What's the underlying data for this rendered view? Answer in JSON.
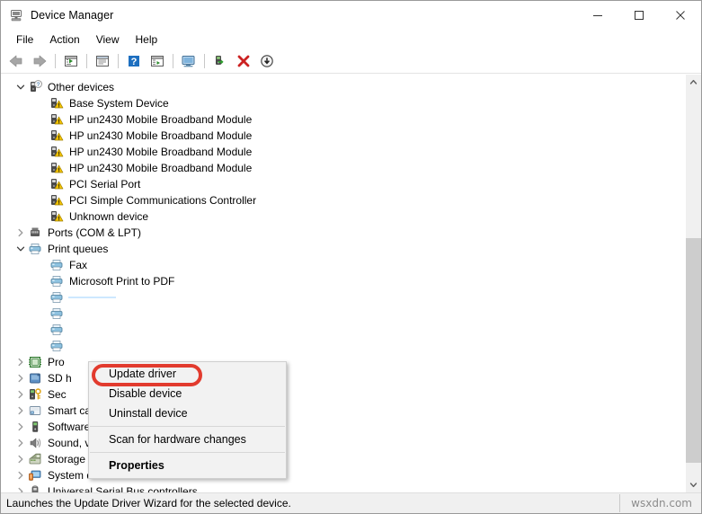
{
  "window": {
    "title": "Device Manager",
    "title_icon": "device-manager-icon",
    "controls": {
      "minimize": "minimize-icon",
      "maximize": "maximize-icon",
      "close": "close-icon"
    }
  },
  "menubar": {
    "items": [
      {
        "label": "File"
      },
      {
        "label": "Action"
      },
      {
        "label": "View"
      },
      {
        "label": "Help"
      }
    ]
  },
  "toolbar": {
    "buttons": [
      {
        "name": "back-arrow-icon"
      },
      {
        "name": "forward-arrow-icon"
      },
      {
        "name": "separator"
      },
      {
        "name": "show-hidden-devices-icon"
      },
      {
        "name": "separator"
      },
      {
        "name": "properties-window-icon"
      },
      {
        "name": "separator"
      },
      {
        "name": "help-icon"
      },
      {
        "name": "view-details-icon"
      },
      {
        "name": "separator"
      },
      {
        "name": "scan-for-hardware-changes-icon"
      },
      {
        "name": "separator"
      },
      {
        "name": "update-driver-icon"
      },
      {
        "name": "uninstall-device-icon"
      },
      {
        "name": "disable-device-icon"
      }
    ]
  },
  "tree": {
    "rows": [
      {
        "label": "Other devices",
        "icon": "unknown-device-icon",
        "twisty": "expanded",
        "indent": 0,
        "selected": false
      },
      {
        "label": "Base System Device",
        "icon": "warning-device-icon",
        "twisty": "none",
        "indent": 1,
        "selected": false
      },
      {
        "label": "HP un2430 Mobile Broadband Module",
        "icon": "warning-device-icon",
        "twisty": "none",
        "indent": 1,
        "selected": false
      },
      {
        "label": "HP un2430 Mobile Broadband Module",
        "icon": "warning-device-icon",
        "twisty": "none",
        "indent": 1,
        "selected": false
      },
      {
        "label": "HP un2430 Mobile Broadband Module",
        "icon": "warning-device-icon",
        "twisty": "none",
        "indent": 1,
        "selected": false
      },
      {
        "label": "HP un2430 Mobile Broadband Module",
        "icon": "warning-device-icon",
        "twisty": "none",
        "indent": 1,
        "selected": false
      },
      {
        "label": "PCI Serial Port",
        "icon": "warning-device-icon",
        "twisty": "none",
        "indent": 1,
        "selected": false
      },
      {
        "label": "PCI Simple Communications Controller",
        "icon": "warning-device-icon",
        "twisty": "none",
        "indent": 1,
        "selected": false
      },
      {
        "label": "Unknown device",
        "icon": "warning-device-icon",
        "twisty": "none",
        "indent": 1,
        "selected": false
      },
      {
        "label": "Ports (COM & LPT)",
        "icon": "port-icon",
        "twisty": "collapsed",
        "indent": 0,
        "selected": false
      },
      {
        "label": "Print queues",
        "icon": "printer-icon",
        "twisty": "expanded",
        "indent": 0,
        "selected": false
      },
      {
        "label": "Fax",
        "icon": "printer-icon",
        "twisty": "none",
        "indent": 1,
        "selected": false
      },
      {
        "label": "Microsoft Print to PDF",
        "icon": "printer-icon",
        "twisty": "none",
        "indent": 1,
        "selected": false
      },
      {
        "label": "",
        "icon": "printer-icon",
        "twisty": "none",
        "indent": 1,
        "selected": true
      },
      {
        "label": "",
        "icon": "printer-icon",
        "twisty": "none",
        "indent": 1,
        "selected": false
      },
      {
        "label": "",
        "icon": "printer-icon",
        "twisty": "none",
        "indent": 1,
        "selected": false
      },
      {
        "label": "",
        "icon": "printer-icon",
        "twisty": "none",
        "indent": 1,
        "selected": false
      },
      {
        "label": "Pro",
        "icon": "processor-icon",
        "twisty": "collapsed",
        "indent": 0,
        "selected": false
      },
      {
        "label": "SD h",
        "icon": "sd-host-icon",
        "twisty": "collapsed",
        "indent": 0,
        "selected": false
      },
      {
        "label": "Sec",
        "icon": "security-device-icon",
        "twisty": "collapsed",
        "indent": 0,
        "selected": false
      },
      {
        "label": "Smart card readers",
        "icon": "smart-card-reader-icon",
        "twisty": "collapsed",
        "indent": 0,
        "selected": false
      },
      {
        "label": "Software devices",
        "icon": "software-device-icon",
        "twisty": "collapsed",
        "indent": 0,
        "selected": false
      },
      {
        "label": "Sound, video and game controllers",
        "icon": "sound-icon",
        "twisty": "collapsed",
        "indent": 0,
        "selected": false
      },
      {
        "label": "Storage controllers",
        "icon": "storage-controller-icon",
        "twisty": "collapsed",
        "indent": 0,
        "selected": false
      },
      {
        "label": "System devices",
        "icon": "system-device-icon",
        "twisty": "collapsed",
        "indent": 0,
        "selected": false
      },
      {
        "label": "Universal Serial Bus controllers",
        "icon": "usb-controller-icon",
        "twisty": "collapsed",
        "indent": 0,
        "selected": false
      }
    ]
  },
  "context_menu": {
    "items": [
      {
        "label": "Update driver",
        "type": "item",
        "bold": false,
        "highlighted": true
      },
      {
        "label": "Disable device",
        "type": "item",
        "bold": false,
        "highlighted": false
      },
      {
        "label": "Uninstall device",
        "type": "item",
        "bold": false,
        "highlighted": false
      },
      {
        "label": "",
        "type": "separator",
        "bold": false,
        "highlighted": false
      },
      {
        "label": "Scan for hardware changes",
        "type": "item",
        "bold": false,
        "highlighted": false
      },
      {
        "label": "",
        "type": "separator",
        "bold": false,
        "highlighted": false
      },
      {
        "label": "Properties",
        "type": "item",
        "bold": true,
        "highlighted": false
      }
    ],
    "highlight_color": "#e23b2e"
  },
  "statusbar": {
    "text": "Launches the Update Driver Wizard for the selected device.",
    "watermark": "wsxdn.com"
  },
  "scrollbar": {
    "up_arrow": "chevron-up-icon",
    "down_arrow": "chevron-down-icon"
  },
  "colors": {
    "selection": "#cde8ff",
    "accent_red": "#e23b2e",
    "chrome": "#f0f0f0"
  }
}
